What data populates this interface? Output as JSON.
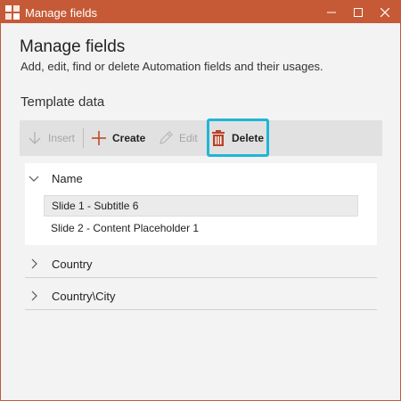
{
  "window": {
    "title": "Manage fields",
    "accent_color": "#c65a36"
  },
  "header": {
    "title": "Manage fields",
    "subtitle": "Add, edit, find or delete Automation fields and their usages."
  },
  "section": {
    "title": "Template data"
  },
  "toolbar": {
    "insert_label": "Insert",
    "create_label": "Create",
    "edit_label": "Edit",
    "delete_label": "Delete",
    "highlight_color": "#1fb6d6"
  },
  "tree": {
    "groups": [
      {
        "label": "Name",
        "expanded": true,
        "items": [
          {
            "label": "Slide 1 - Subtitle 6",
            "selected": true
          },
          {
            "label": "Slide 2 - Content Placeholder 1",
            "selected": false
          }
        ]
      },
      {
        "label": "Country",
        "expanded": false
      },
      {
        "label": "Country\\City",
        "expanded": false
      }
    ]
  }
}
